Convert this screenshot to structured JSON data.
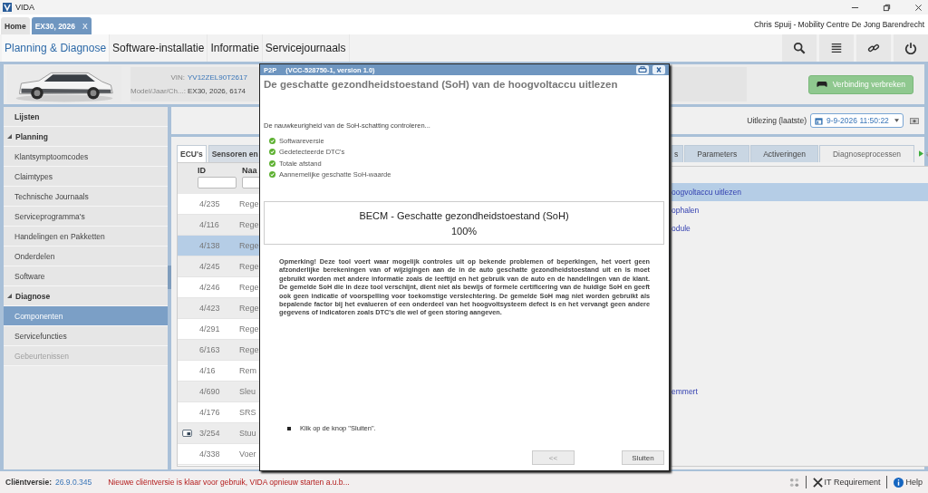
{
  "window": {
    "app_name": "VIDA"
  },
  "doc_tabs": [
    {
      "label": "Home",
      "selected": false
    },
    {
      "label": "EX30, 2026",
      "selected": true,
      "close": "X"
    }
  ],
  "user": "Chris Spuij - Mobility Centre De Jong Barendrecht",
  "nav": [
    {
      "label": "Planning & Diagnose",
      "selected": true
    },
    {
      "label": "Software-installatie",
      "selected": false
    },
    {
      "label": "Informatie",
      "selected": false
    },
    {
      "label": "Servicejournaals",
      "selected": false
    }
  ],
  "vehicle": {
    "vin_label": "VIN:",
    "vin": "YV12ZEL90T2617",
    "model_label": "Model/Jaar/Ch...:",
    "model": "EX30, 2026, 6174",
    "disconnect": "Verbinding verbreken"
  },
  "sidebar": [
    {
      "kind": "item",
      "label": "Lijsten",
      "selected": false,
      "disabled": false
    },
    {
      "kind": "group",
      "label": "Planning",
      "expanded": true,
      "children": [
        {
          "label": "Klantsymptoomcodes",
          "selected": false,
          "disabled": false
        },
        {
          "label": "Claimtypes",
          "selected": false,
          "disabled": false
        },
        {
          "label": "Technische Journaals",
          "selected": false,
          "disabled": false
        },
        {
          "label": "Serviceprogramma's",
          "selected": false,
          "disabled": false
        },
        {
          "label": "Handelingen en Pakketten",
          "selected": false,
          "disabled": false
        },
        {
          "label": "Onderdelen",
          "selected": false,
          "disabled": false
        },
        {
          "label": "Software",
          "selected": false,
          "disabled": false
        }
      ]
    },
    {
      "kind": "group",
      "label": "Diagnose",
      "expanded": true,
      "children": [
        {
          "label": "Componenten",
          "selected": true,
          "disabled": false
        },
        {
          "label": "Servicefuncties",
          "selected": false,
          "disabled": false
        },
        {
          "label": "Gebeurtenissen",
          "selected": false,
          "disabled": true
        }
      ]
    }
  ],
  "readout": {
    "label": "Uitlezing (laatste)",
    "value": "9-9-2026 11:50:22"
  },
  "ecu_tabs": [
    {
      "label": "ECU's",
      "selected": true
    },
    {
      "label": "Sensoren en",
      "selected": false
    }
  ],
  "ecu_table": {
    "columns": [
      "ID",
      "Naa"
    ],
    "rows": [
      {
        "id": "4/235",
        "name": "Rege",
        "selected": false,
        "device": false
      },
      {
        "id": "4/116",
        "name": "Rege",
        "selected": false,
        "device": false
      },
      {
        "id": "4/138",
        "name": "Rege",
        "selected": true,
        "device": false
      },
      {
        "id": "4/245",
        "name": "Rege",
        "selected": false,
        "device": false
      },
      {
        "id": "4/246",
        "name": "Rege",
        "selected": false,
        "device": false
      },
      {
        "id": "4/423",
        "name": "Rege",
        "selected": false,
        "device": false
      },
      {
        "id": "4/291",
        "name": "Rege",
        "selected": false,
        "device": false
      },
      {
        "id": "6/163",
        "name": "Rege",
        "selected": false,
        "device": false
      },
      {
        "id": "4/16",
        "name": "Rem",
        "selected": false,
        "device": false
      },
      {
        "id": "4/690",
        "name": "Sleu",
        "selected": false,
        "device": false
      },
      {
        "id": "4/176",
        "name": "SRS",
        "selected": false,
        "device": false
      },
      {
        "id": "3/254",
        "name": "Stuu",
        "selected": false,
        "device": true
      },
      {
        "id": "4/338",
        "name": "Voer",
        "selected": false,
        "device": false
      }
    ]
  },
  "main_tabs": [
    {
      "label": "s",
      "selected": false
    },
    {
      "label": "Parameters",
      "selected": false
    },
    {
      "label": "Activeringen",
      "selected": false
    },
    {
      "label": "Diagnoseprocessen",
      "selected": true
    }
  ],
  "processes": [
    {
      "label": "oogvoltaccu uitlezen",
      "selected": true
    },
    {
      "label": "ophalen",
      "selected": false
    },
    {
      "label": "odule",
      "selected": false
    }
  ],
  "processes_lower": [
    {
      "label": "emmert",
      "selected": false
    }
  ],
  "modal": {
    "tag": "P2P",
    "code": "(VCC-528750-1, version 1.0)",
    "heading": "De geschatte gezondheidstoestand (SoH) van de hoogvoltaccu uitlezen",
    "intro": "De nauwkeurigheid van de SoH-schatting controleren...",
    "checks": [
      {
        "label": "Softwareversie",
        "passed": true
      },
      {
        "label": "Gedetecteerde DTC's",
        "passed": true
      },
      {
        "label": "Totale afstand",
        "passed": true
      },
      {
        "label": "Aannemelijke geschatte SoH-waarde",
        "passed": true
      }
    ],
    "result": {
      "title": "BECM - Geschatte gezondheidstoestand (SoH)",
      "value": "100%"
    },
    "note": "Opmerking!  Deze tool voert waar mogelijk controles uit op bekende problemen of beperkingen, het voert geen afzonderlijke berekeningen van of wijzigingen aan de in de auto geschatte gezondheidstoestand uit en is moet gebruikt worden met andere informatie zoals de leeftijd en het gebruik van de auto en de handelingen van de klant. De gemelde SoH die in deze tool verschijnt, dient niet als bewijs of formele certificering van de huidige SoH en geeft ook geen indicatie of voorspelling voor toekomstige verslechtering. De gemelde SoH mag niet worden gebruikt als bepalende factor bij het evalueren of een onderdeel van het hoogvoltsysteem defect is en het vervangt geen andere gegevens of indicatoren zoals DTC's die wel of geen storing aangeven.",
    "instruction": "Klik op de knop \"Sluiten\".",
    "buttons": [
      {
        "label": "<<",
        "kind": "back"
      },
      {
        "label": "Sluiten",
        "kind": "close"
      }
    ]
  },
  "status": {
    "version_label": "Cliëntversie:",
    "version": "26.9.0.345",
    "message": "Nieuwe cliëntversie is klaar voor gebruik, VIDA opnieuw starten a.u.b...",
    "links": [
      {
        "label": "IT Requirement",
        "kind": "tools"
      },
      {
        "label": "Help",
        "kind": "help"
      }
    ]
  }
}
